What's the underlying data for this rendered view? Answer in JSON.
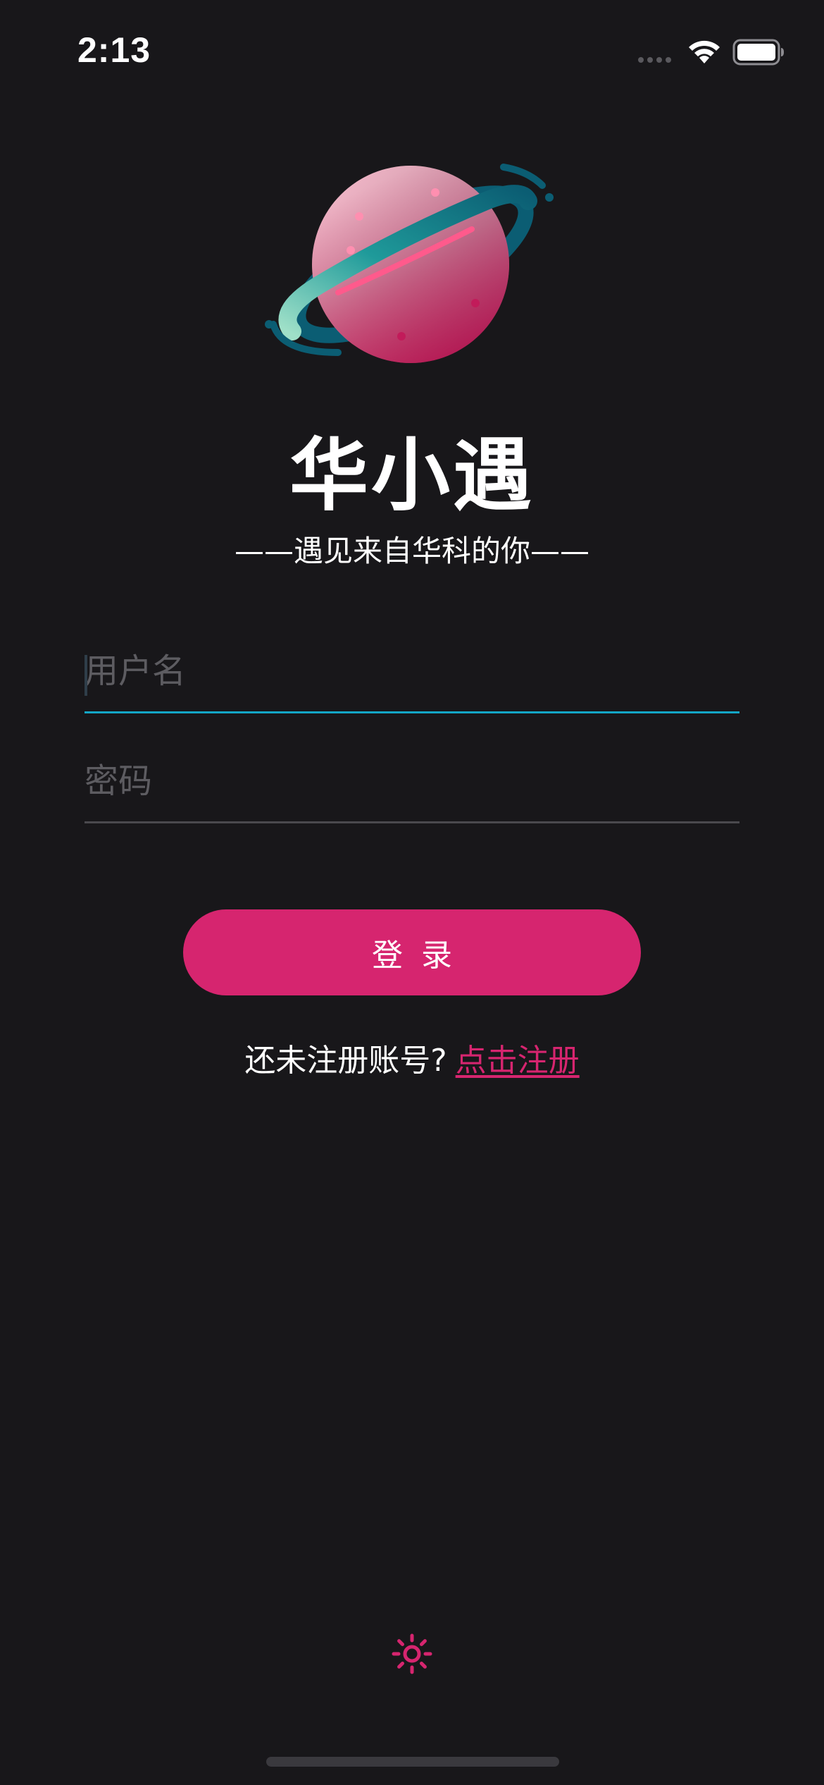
{
  "status_bar": {
    "time": "2:13"
  },
  "app": {
    "title": "华小遇",
    "slogan": "——遇见来自华科的你——"
  },
  "form": {
    "username_placeholder": "用户名",
    "username_value": "",
    "password_placeholder": "密码",
    "password_value": "",
    "login_label": "登录"
  },
  "register": {
    "prompt": "还未注册账号?",
    "link_label": "点击注册"
  },
  "icons": {
    "logo": "planet-logo-icon",
    "theme": "sun-icon",
    "wifi": "wifi-icon",
    "battery": "battery-icon",
    "signal": "cellular-signal-icon"
  },
  "colors": {
    "background": "#18171a",
    "accent": "#d6256f",
    "focus_underline": "#14a6c6",
    "placeholder": "#5d5c61"
  }
}
